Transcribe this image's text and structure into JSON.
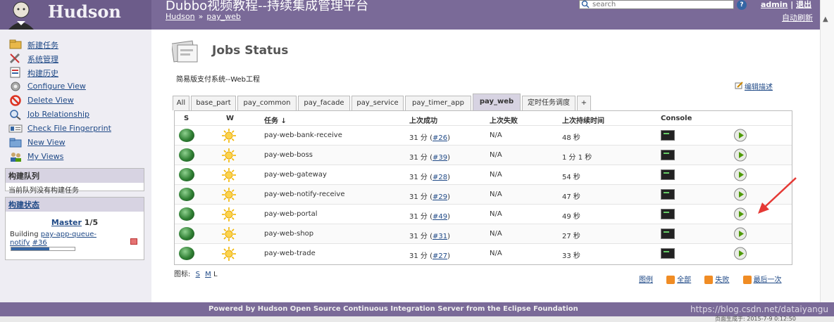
{
  "header": {
    "logo_text": "Hudson",
    "app_title": "Dubbo视频教程--持续集成管理平台",
    "breadcrumb": [
      "Hudson",
      "pay_web"
    ],
    "breadcrumb_sep": "»",
    "search_placeholder": "search",
    "help_label": "?",
    "login": "admin",
    "login_sep": "|",
    "logout": "退出",
    "refresh": "自动刷新",
    "scroll_arrow": "▲"
  },
  "sidebar": {
    "tasks": [
      {
        "label": "新建任务",
        "icon": "new-job-icon"
      },
      {
        "label": "系统管理",
        "icon": "manage-icon"
      },
      {
        "label": "构建历史",
        "icon": "history-icon"
      },
      {
        "label": "Configure View",
        "icon": "configure-icon"
      },
      {
        "label": "Delete View",
        "icon": "delete-icon"
      },
      {
        "label": "Job Relationship",
        "icon": "search-icon"
      },
      {
        "label": "Check File Fingerprint",
        "icon": "fingerprint-icon"
      },
      {
        "label": "New View",
        "icon": "folder-icon"
      },
      {
        "label": "My Views",
        "icon": "users-icon"
      }
    ],
    "queue": {
      "title": "构建队列",
      "empty_text": "当前队列没有构建任务"
    },
    "executor": {
      "title": "构建状态",
      "master_link": "Master",
      "master_count": "1/5",
      "building_prefix": "Building",
      "building_job": "pay-app-queue-notify",
      "building_number": "#36",
      "progress": 0.6
    }
  },
  "main": {
    "title": "Jobs Status",
    "description": "简易版支付系统--Web工程",
    "edit_description": "编辑描述",
    "tabs": [
      {
        "label": "All",
        "active": false
      },
      {
        "label": "base_part",
        "active": false
      },
      {
        "label": "pay_common",
        "active": false
      },
      {
        "label": "pay_facade",
        "active": false
      },
      {
        "label": "pay_service",
        "active": false
      },
      {
        "label": "pay_timer_app",
        "active": false
      },
      {
        "label": "pay_web",
        "active": true
      },
      {
        "label": "定时任务调度",
        "active": false
      },
      {
        "label": "+",
        "active": false
      }
    ],
    "columns": {
      "s": "S",
      "w": "W",
      "job": "任务 ↓",
      "last_success": "上次成功",
      "last_failure": "上次失败",
      "last_duration": "上次持续时间",
      "console": "Console"
    },
    "jobs": [
      {
        "name": "pay-web-bank-receive",
        "success_time": "31 分",
        "success_build": "#26",
        "failure": "N/A",
        "duration": "48 秒"
      },
      {
        "name": "pay-web-boss",
        "success_time": "31 分",
        "success_build": "#39",
        "failure": "N/A",
        "duration": "1 分 1 秒"
      },
      {
        "name": "pay-web-gateway",
        "success_time": "31 分",
        "success_build": "#28",
        "failure": "N/A",
        "duration": "54 秒"
      },
      {
        "name": "pay-web-notify-receive",
        "success_time": "31 分",
        "success_build": "#29",
        "failure": "N/A",
        "duration": "47 秒"
      },
      {
        "name": "pay-web-portal",
        "success_time": "31 分",
        "success_build": "#49",
        "failure": "N/A",
        "duration": "49 秒"
      },
      {
        "name": "pay-web-shop",
        "success_time": "31 分",
        "success_build": "#31",
        "failure": "N/A",
        "duration": "27 秒"
      },
      {
        "name": "pay-web-trade",
        "success_time": "31 分",
        "success_build": "#27",
        "failure": "N/A",
        "duration": "33 秒"
      }
    ],
    "icon_size": {
      "label": "图标:",
      "options": [
        "S",
        "M",
        "L"
      ]
    },
    "legend_links": [
      "图例",
      "全部",
      "失败",
      "最后一次"
    ]
  },
  "footer": {
    "text": "Powered by Hudson Open Source Continuous Integration Server from the Eclipse Foundation",
    "page_generated": "页面生成于: 2015-7-9 0:12:50"
  },
  "watermark": "https://blog.csdn.net/dataiyangu",
  "colors": {
    "header": "#7a6a98",
    "sidebar": "#eeedf3",
    "link": "#204a87",
    "arrow": "#e53935"
  }
}
